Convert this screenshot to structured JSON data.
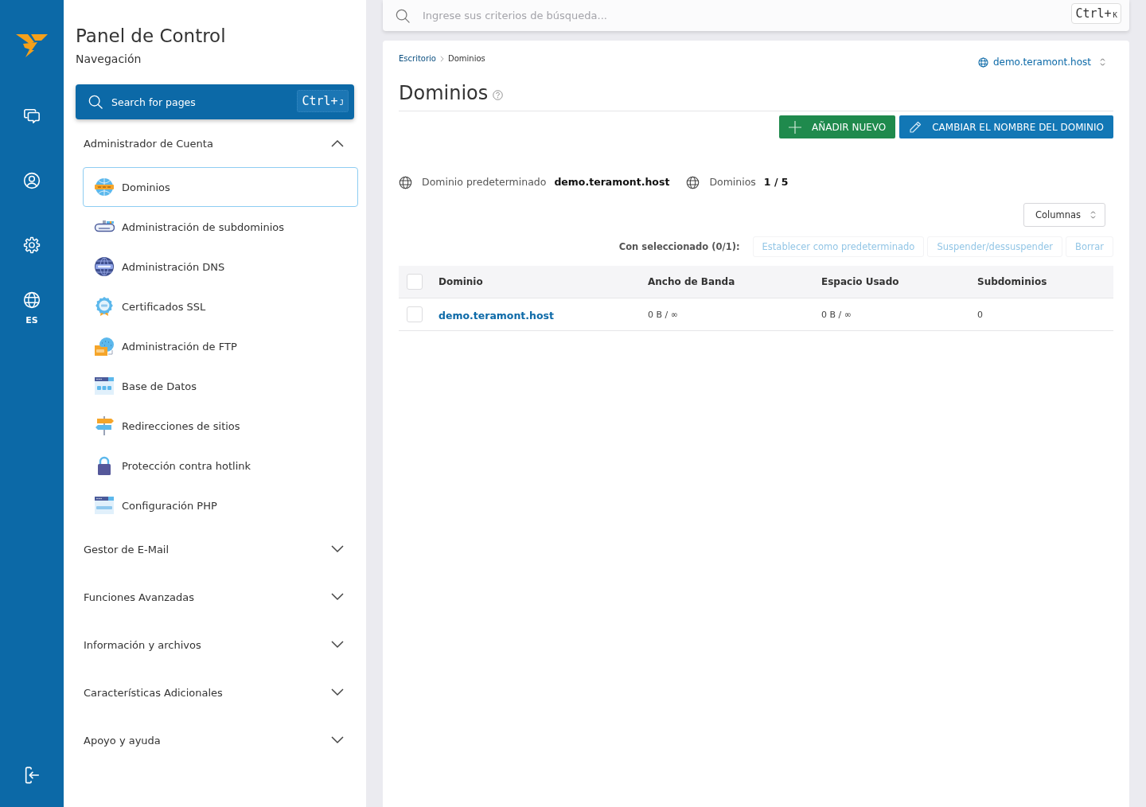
{
  "rail": {
    "language": "ES"
  },
  "sidebar": {
    "title": "Panel de Control",
    "subtitle": "Navegación",
    "search": {
      "placeholder": "Search for pages",
      "shortcut": {
        "modifier": "Ctrl+",
        "key": "J"
      }
    },
    "groups": [
      {
        "label": "Administrador de Cuenta",
        "expanded": true,
        "items": [
          {
            "label": "Dominios",
            "selected": true
          },
          {
            "label": "Administración de subdominios",
            "selected": false
          },
          {
            "label": "Administración DNS",
            "selected": false
          },
          {
            "label": "Certificados SSL",
            "selected": false
          },
          {
            "label": "Administración de FTP",
            "selected": false
          },
          {
            "label": "Base de Datos",
            "selected": false
          },
          {
            "label": "Redirecciones de sitios",
            "selected": false
          },
          {
            "label": "Protección contra hotlink",
            "selected": false
          },
          {
            "label": "Configuración PHP",
            "selected": false
          }
        ]
      },
      {
        "label": "Gestor de E-Mail",
        "expanded": false
      },
      {
        "label": "Funciones Avanzadas",
        "expanded": false
      },
      {
        "label": "Información y archivos",
        "expanded": false
      },
      {
        "label": "Características Adicionales",
        "expanded": false
      },
      {
        "label": "Apoyo y ayuda",
        "expanded": false
      }
    ]
  },
  "search": {
    "placeholder": "Ingrese sus criterios de búsqueda...",
    "shortcut": {
      "modifier": "Ctrl+",
      "key": "K"
    }
  },
  "breadcrumb": [
    "Escritorio",
    "Dominios"
  ],
  "domain_switcher": "demo.teramont.host",
  "page_title": "Dominios",
  "actions": [
    {
      "kind": "add",
      "label": "AÑADIR NUEVO"
    },
    {
      "kind": "rename",
      "label": "CAMBIAR EL NOMBRE DEL DOMINIO"
    }
  ],
  "stats": [
    {
      "label": "Dominio predeterminado",
      "value": "demo.teramont.host"
    },
    {
      "label": "Dominios",
      "value": "1 / 5"
    }
  ],
  "columns_button": "Columnas",
  "bulk_actions": {
    "label": "Con seleccionado (0/1):",
    "items": [
      {
        "label": "Establecer como predeterminado",
        "disabled": true
      },
      {
        "label": "Suspender/dessuspender",
        "disabled": true
      },
      {
        "label": "Borrar",
        "disabled": true
      }
    ]
  },
  "table": {
    "header_checked": false,
    "columns": [
      "Dominio",
      "Ancho de Banda",
      "Espacio Usado",
      "Subdominios"
    ],
    "rows": [
      {
        "checked": false,
        "cells": [
          "demo.teramont.host",
          "0 B / ∞",
          "0 B / ∞",
          "0"
        ]
      }
    ]
  }
}
